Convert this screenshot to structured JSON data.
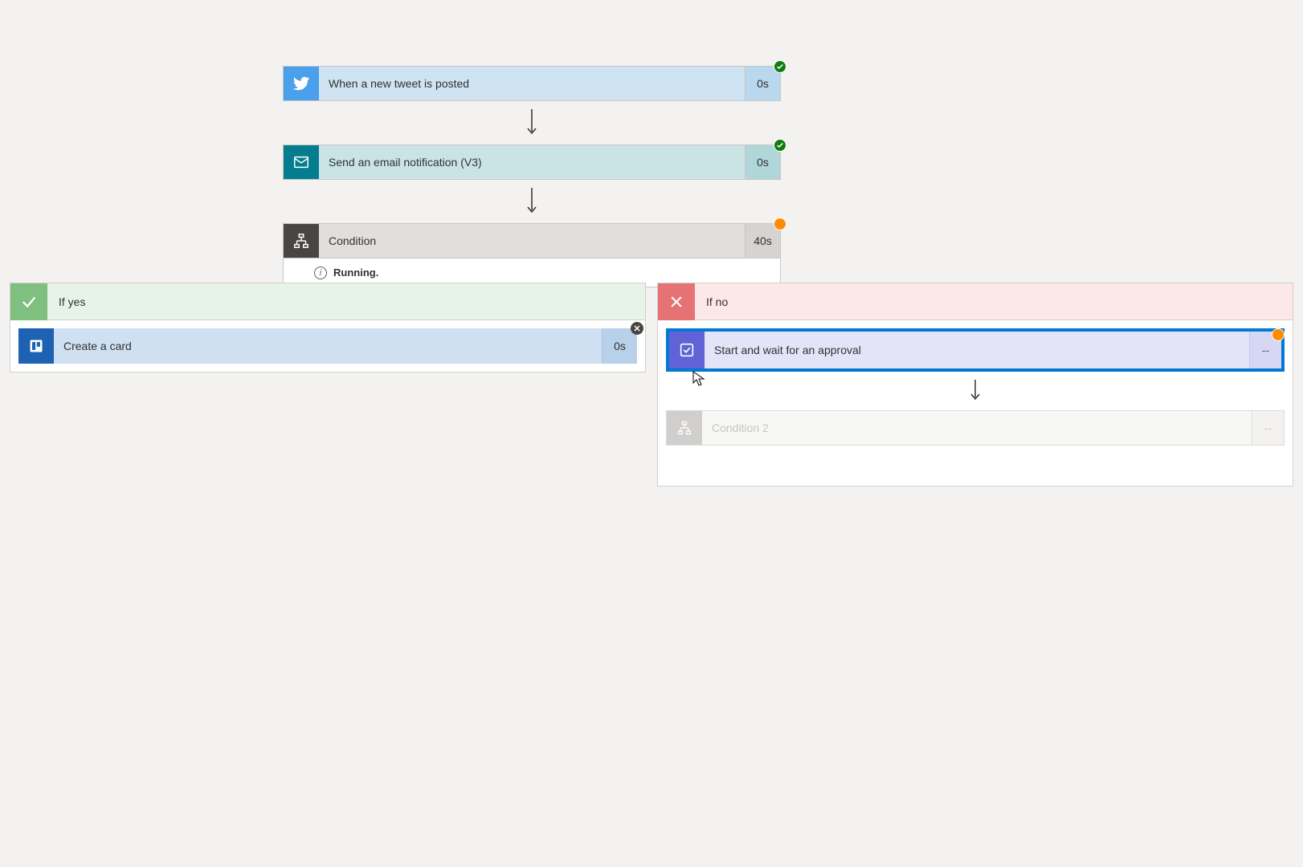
{
  "flow": {
    "twitter_step": {
      "label": "When a new tweet is posted",
      "duration": "0s",
      "status": "success"
    },
    "email_step": {
      "label": "Send an email notification (V3)",
      "duration": "0s",
      "status": "success"
    },
    "condition_step": {
      "label": "Condition",
      "duration": "40s",
      "status": "warning",
      "running_text": "Running."
    }
  },
  "branches": {
    "yes": {
      "title": "If yes",
      "trello_card": {
        "label": "Create a card",
        "duration": "0s"
      }
    },
    "no": {
      "title": "If no",
      "approval_card": {
        "label": "Start and wait for an approval",
        "duration": "--",
        "status": "warning"
      },
      "condition2_card": {
        "label": "Condition 2",
        "duration": "--"
      }
    }
  }
}
